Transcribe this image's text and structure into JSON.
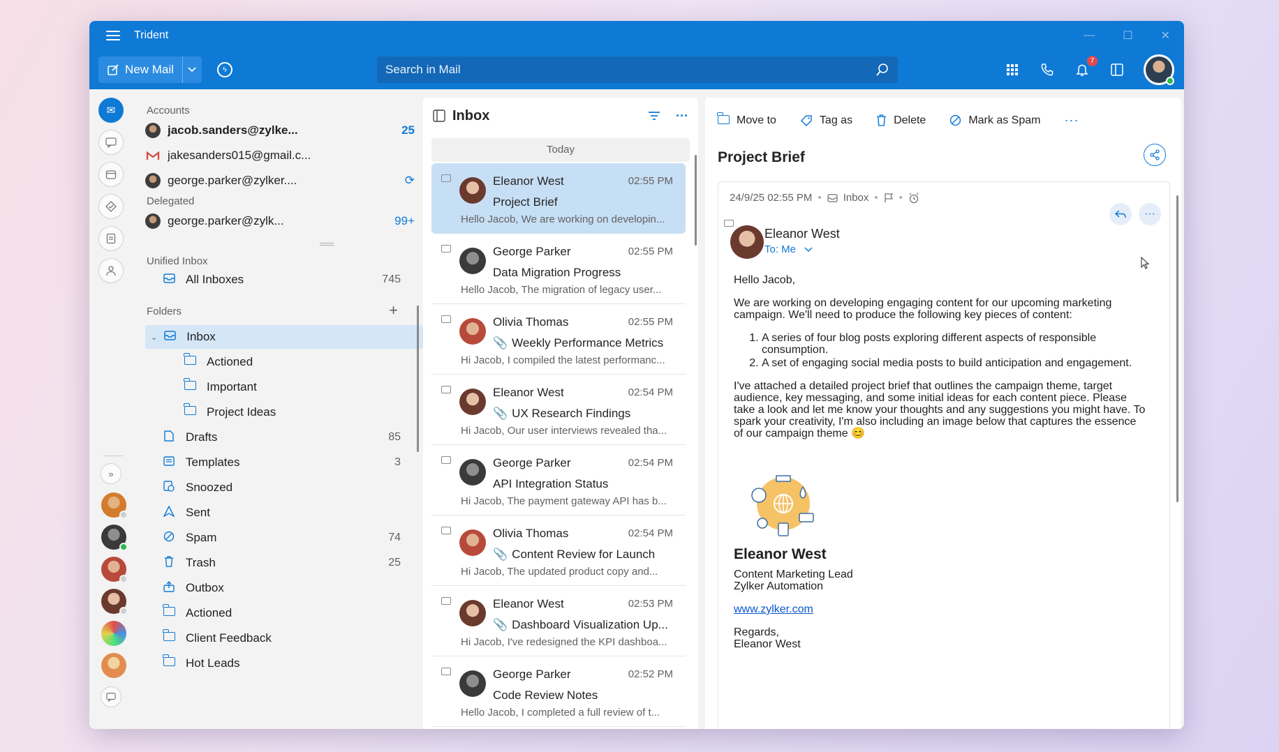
{
  "window": {
    "title": "Trident"
  },
  "toolbar": {
    "new_mail_label": "New Mail",
    "search_placeholder": "Search in Mail",
    "notification_count": "7"
  },
  "accounts": {
    "label": "Accounts",
    "items": [
      {
        "email": "jacob.sanders@zylke...",
        "count": "25",
        "icon": "avatar"
      },
      {
        "email": "jakesanders015@gmail.c...",
        "count": "",
        "icon": "gmail-icon"
      },
      {
        "email": "george.parker@zylker....",
        "count": "",
        "icon": "avatar"
      }
    ]
  },
  "delegated": {
    "label": "Delegated",
    "items": [
      {
        "email": "george.parker@zylk...",
        "count": "99+"
      }
    ]
  },
  "unified": {
    "label": "Unified Inbox",
    "all_inboxes": {
      "label": "All Inboxes",
      "count": "745"
    }
  },
  "folders": {
    "label": "Folders",
    "items": [
      {
        "label": "Inbox",
        "count": ""
      },
      {
        "label": "Actioned",
        "count": ""
      },
      {
        "label": "Important",
        "count": ""
      },
      {
        "label": "Project Ideas",
        "count": ""
      },
      {
        "label": "Drafts",
        "count": "85"
      },
      {
        "label": "Templates",
        "count": "3"
      },
      {
        "label": "Snoozed",
        "count": ""
      },
      {
        "label": "Sent",
        "count": ""
      },
      {
        "label": "Spam",
        "count": "74"
      },
      {
        "label": "Trash",
        "count": "25"
      },
      {
        "label": "Outbox",
        "count": ""
      },
      {
        "label": "Actioned",
        "count": ""
      },
      {
        "label": "Client Feedback",
        "count": ""
      },
      {
        "label": "Hot Leads",
        "count": ""
      }
    ]
  },
  "maillist": {
    "title": "Inbox",
    "day_label": "Today",
    "items": [
      {
        "sender": "Eleanor West",
        "time": "02:55 PM",
        "subject": "Project Brief",
        "attachment": false,
        "preview": "Hello Jacob, We are working on developin..."
      },
      {
        "sender": "George Parker",
        "time": "02:55 PM",
        "subject": "Data Migration Progress",
        "attachment": false,
        "preview": "Hello Jacob, The migration of legacy user..."
      },
      {
        "sender": "Olivia Thomas",
        "time": "02:55 PM",
        "subject": "Weekly Performance Metrics",
        "attachment": true,
        "preview": "Hi Jacob, I compiled the latest performanc..."
      },
      {
        "sender": "Eleanor West",
        "time": "02:54 PM",
        "subject": "UX Research Findings",
        "attachment": true,
        "preview": "Hi Jacob, Our user interviews revealed tha..."
      },
      {
        "sender": "George Parker",
        "time": "02:54 PM",
        "subject": "API Integration Status",
        "attachment": false,
        "preview": "Hi Jacob, The payment gateway API has b..."
      },
      {
        "sender": "Olivia Thomas",
        "time": "02:54 PM",
        "subject": "Content Review for Launch",
        "attachment": true,
        "preview": "Hi Jacob, The updated product copy and..."
      },
      {
        "sender": "Eleanor West",
        "time": "02:53 PM",
        "subject": "Dashboard Visualization Up...",
        "attachment": true,
        "preview": "Hi Jacob, I've redesigned the KPI dashboa..."
      },
      {
        "sender": "George Parker",
        "time": "02:52 PM",
        "subject": "Code Review Notes",
        "attachment": false,
        "preview": "Hello Jacob, I completed a full review of t..."
      }
    ]
  },
  "reading": {
    "actions": {
      "move": "Move to",
      "tag": "Tag as",
      "delete": "Delete",
      "spam": "Mark as Spam"
    },
    "subject": "Project Brief",
    "meta_date": "24/9/25 02:55 PM",
    "meta_folder": "Inbox",
    "from": "Eleanor West",
    "to": "To: Me",
    "greeting": "Hello Jacob,",
    "para1": "We are working on developing engaging content for our upcoming marketing campaign. We'll need to produce the following key pieces of content:",
    "list": [
      "A series of four blog posts exploring different aspects of responsible consumption.",
      "A set of engaging social media posts to build anticipation and engagement."
    ],
    "para2": "I've attached a detailed project brief that outlines the campaign theme, target audience, key messaging, and some initial ideas for each content piece. Please take a look and let me know your thoughts and any suggestions you might have. To spark your creativity, I'm also including an image below that captures the essence of our campaign theme 😊",
    "sig_name": "Eleanor West",
    "sig_title": "Content Marketing Lead",
    "sig_company": "Zylker Automation",
    "sig_link": "www.zylker.com",
    "closing": "Regards,",
    "closing_name": "Eleanor West"
  },
  "colors": {
    "accent": "#0f7ad6",
    "selected_bg": "#c7dff5",
    "badge": "#e5484d"
  }
}
